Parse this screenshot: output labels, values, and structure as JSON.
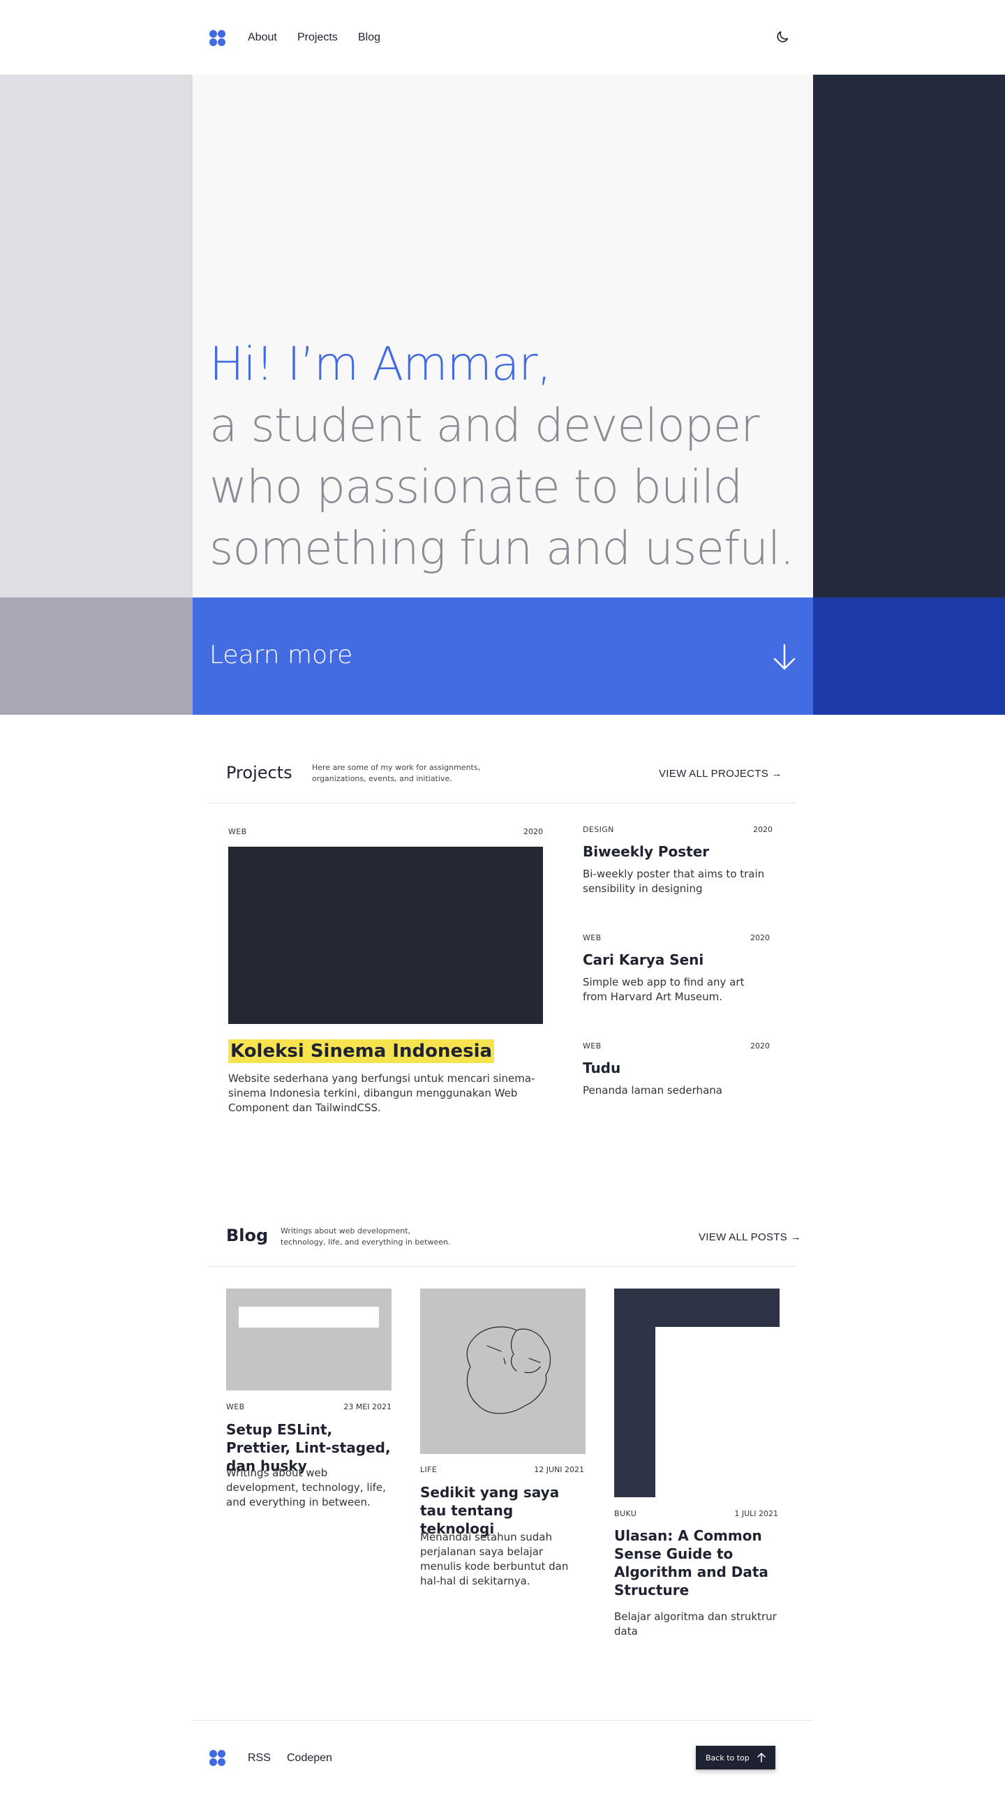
{
  "nav": {
    "links": [
      "About",
      "Projects",
      "Blog"
    ],
    "theme_toggle_icon": "moon-icon"
  },
  "hero": {
    "greeting": "Hi! I’m Ammar,",
    "lines": [
      "a student and developer",
      "who passionate to build",
      "something fun and useful."
    ],
    "learn_more": "Learn more",
    "colors": {
      "accent": "#4169e1",
      "muted": "#8b8a94",
      "dark": "#242a3d",
      "cta": "#436ce2"
    }
  },
  "projects": {
    "title": "Projects",
    "description": "Here are some of my work for assignments, organizations, events, and initiative.",
    "view_all": "VIEW ALL PROJECTS →",
    "featured": {
      "category": "WEB",
      "year": "2020",
      "title": "Koleksi Sinema Indonesia",
      "description": "Website sederhana yang berfungsi untuk mencari sinema-sinema Indonesia terkini, dibangun menggunakan Web Component dan TailwindCSS."
    },
    "items": [
      {
        "category": "DESIGN",
        "year": "2020",
        "title": "Biweekly Poster",
        "description": "Bi-weekly poster that aims to train sensibility in designing"
      },
      {
        "category": "WEB",
        "year": "2020",
        "title": "Cari Karya Seni",
        "description": "Simple web app to find any art from Harvard Art Museum."
      },
      {
        "category": "WEB",
        "year": "2020",
        "title": "Tudu",
        "description": "Penanda laman sederhana"
      }
    ]
  },
  "blog": {
    "title": "Blog",
    "description": "Writings about web development, technology, life, and everything in between.",
    "view_all": "VIEW ALL POSTS →",
    "posts": [
      {
        "category": "WEB",
        "date": "23 MEI 2021",
        "title": "Setup ESLint, Prettier, Lint-staged, dan husky",
        "description": "Writings about web development, technology, life, and everything in between."
      },
      {
        "category": "LIFE",
        "date": "12 JUNI 2021",
        "title": "Sedikit yang saya tau tentang teknologi",
        "description": "Menandai setahun sudah perjalanan saya belajar menulis kode berbuntut dan hal-hal di sekitarnya."
      },
      {
        "category": "BUKU",
        "date": "1 JULI 2021",
        "title": "Ulasan: A Common Sense Guide to Algorithm and Data Structure",
        "description": "Belajar algoritma dan struktrur data"
      }
    ]
  },
  "footer": {
    "links": [
      "RSS",
      "Codepen"
    ],
    "back_to_top": "Back to top"
  }
}
